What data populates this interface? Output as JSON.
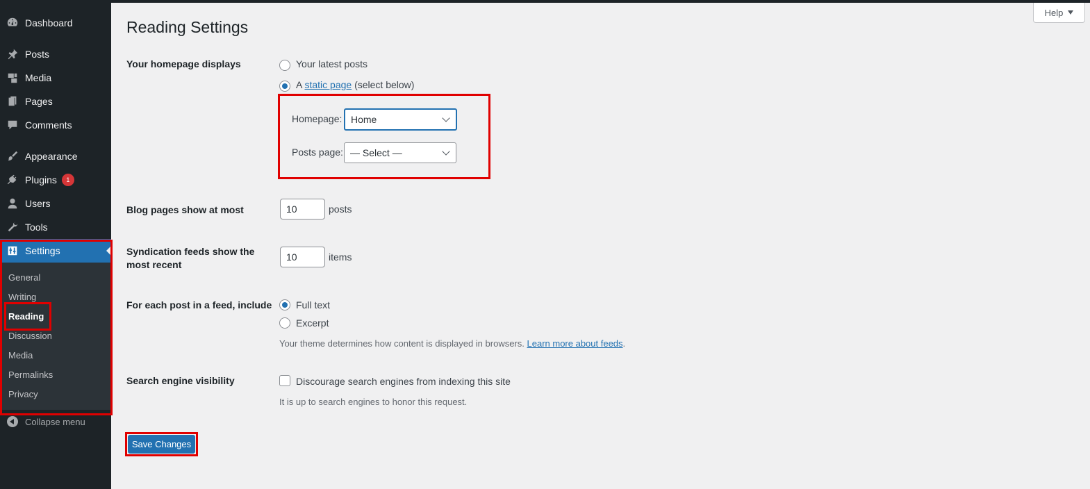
{
  "sidebar": {
    "menu": [
      {
        "label": "Dashboard",
        "icon": "dashboard-icon"
      },
      {
        "label": "Posts",
        "icon": "pin-icon"
      },
      {
        "label": "Media",
        "icon": "media-icon"
      },
      {
        "label": "Pages",
        "icon": "pages-icon"
      },
      {
        "label": "Comments",
        "icon": "comment-icon"
      },
      {
        "label": "Appearance",
        "icon": "brush-icon"
      },
      {
        "label": "Plugins",
        "icon": "plug-icon",
        "badge": "1"
      },
      {
        "label": "Users",
        "icon": "user-icon"
      },
      {
        "label": "Tools",
        "icon": "wrench-icon"
      },
      {
        "label": "Settings",
        "icon": "settings-icon"
      }
    ],
    "submenu": [
      "General",
      "Writing",
      "Reading",
      "Discussion",
      "Media",
      "Permalinks",
      "Privacy"
    ],
    "current_submenu": "Reading",
    "collapse_label": "Collapse menu"
  },
  "header": {
    "help_label": "Help",
    "title": "Reading Settings"
  },
  "homepage": {
    "label": "Your homepage displays",
    "option_latest": "Your latest posts",
    "option_static_prefix": "A",
    "option_static_link": "static page",
    "option_static_suffix": "(select below)",
    "selected": "static",
    "homepage_label": "Homepage:",
    "homepage_value": "Home",
    "posts_page_label": "Posts page:",
    "posts_page_value": "— Select —"
  },
  "blog_pages": {
    "label": "Blog pages show at most",
    "value": "10",
    "unit": "posts"
  },
  "syndication": {
    "label_line1": "Syndication feeds show the",
    "label_line2": "most recent",
    "value": "10",
    "unit": "items"
  },
  "feed_content": {
    "label": "For each post in a feed, include",
    "option_full": "Full text",
    "option_excerpt": "Excerpt",
    "selected": "full",
    "desc_text": "Your theme determines how content is displayed in browsers.",
    "desc_link": "Learn more about feeds",
    "desc_end": "."
  },
  "search_visibility": {
    "label": "Search engine visibility",
    "checkbox_label": "Discourage search engines from indexing this site",
    "checked": false,
    "desc": "It is up to search engines to honor this request."
  },
  "save_label": "Save Changes",
  "colors": {
    "sidebar_bg": "#1d2327",
    "accent": "#2271b1",
    "highlight": "#e00000",
    "page_bg": "#f0f0f1"
  }
}
